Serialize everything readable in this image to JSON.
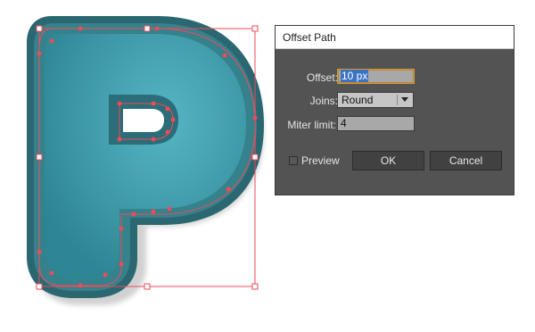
{
  "dialog": {
    "title": "Offset Path",
    "offset": {
      "label": "Offset:",
      "value": "10 px"
    },
    "joins": {
      "label": "Joins:",
      "value": "Round"
    },
    "miter_limit": {
      "label": "Miter limit:",
      "value": "4"
    },
    "preview": {
      "label": "Preview",
      "checked": false
    },
    "ok_label": "OK",
    "cancel_label": "Cancel"
  },
  "colors": {
    "letter_fill": "#3d9aa7",
    "letter_edge": "#2b6c77",
    "selection": "#ee4b57",
    "dialog_bg": "#535353",
    "field_highlight": "#3d73c2"
  },
  "artwork": {
    "letter": "P",
    "icons": [
      "selection-bounding-box",
      "anchor-point",
      "bounding-handle"
    ]
  }
}
